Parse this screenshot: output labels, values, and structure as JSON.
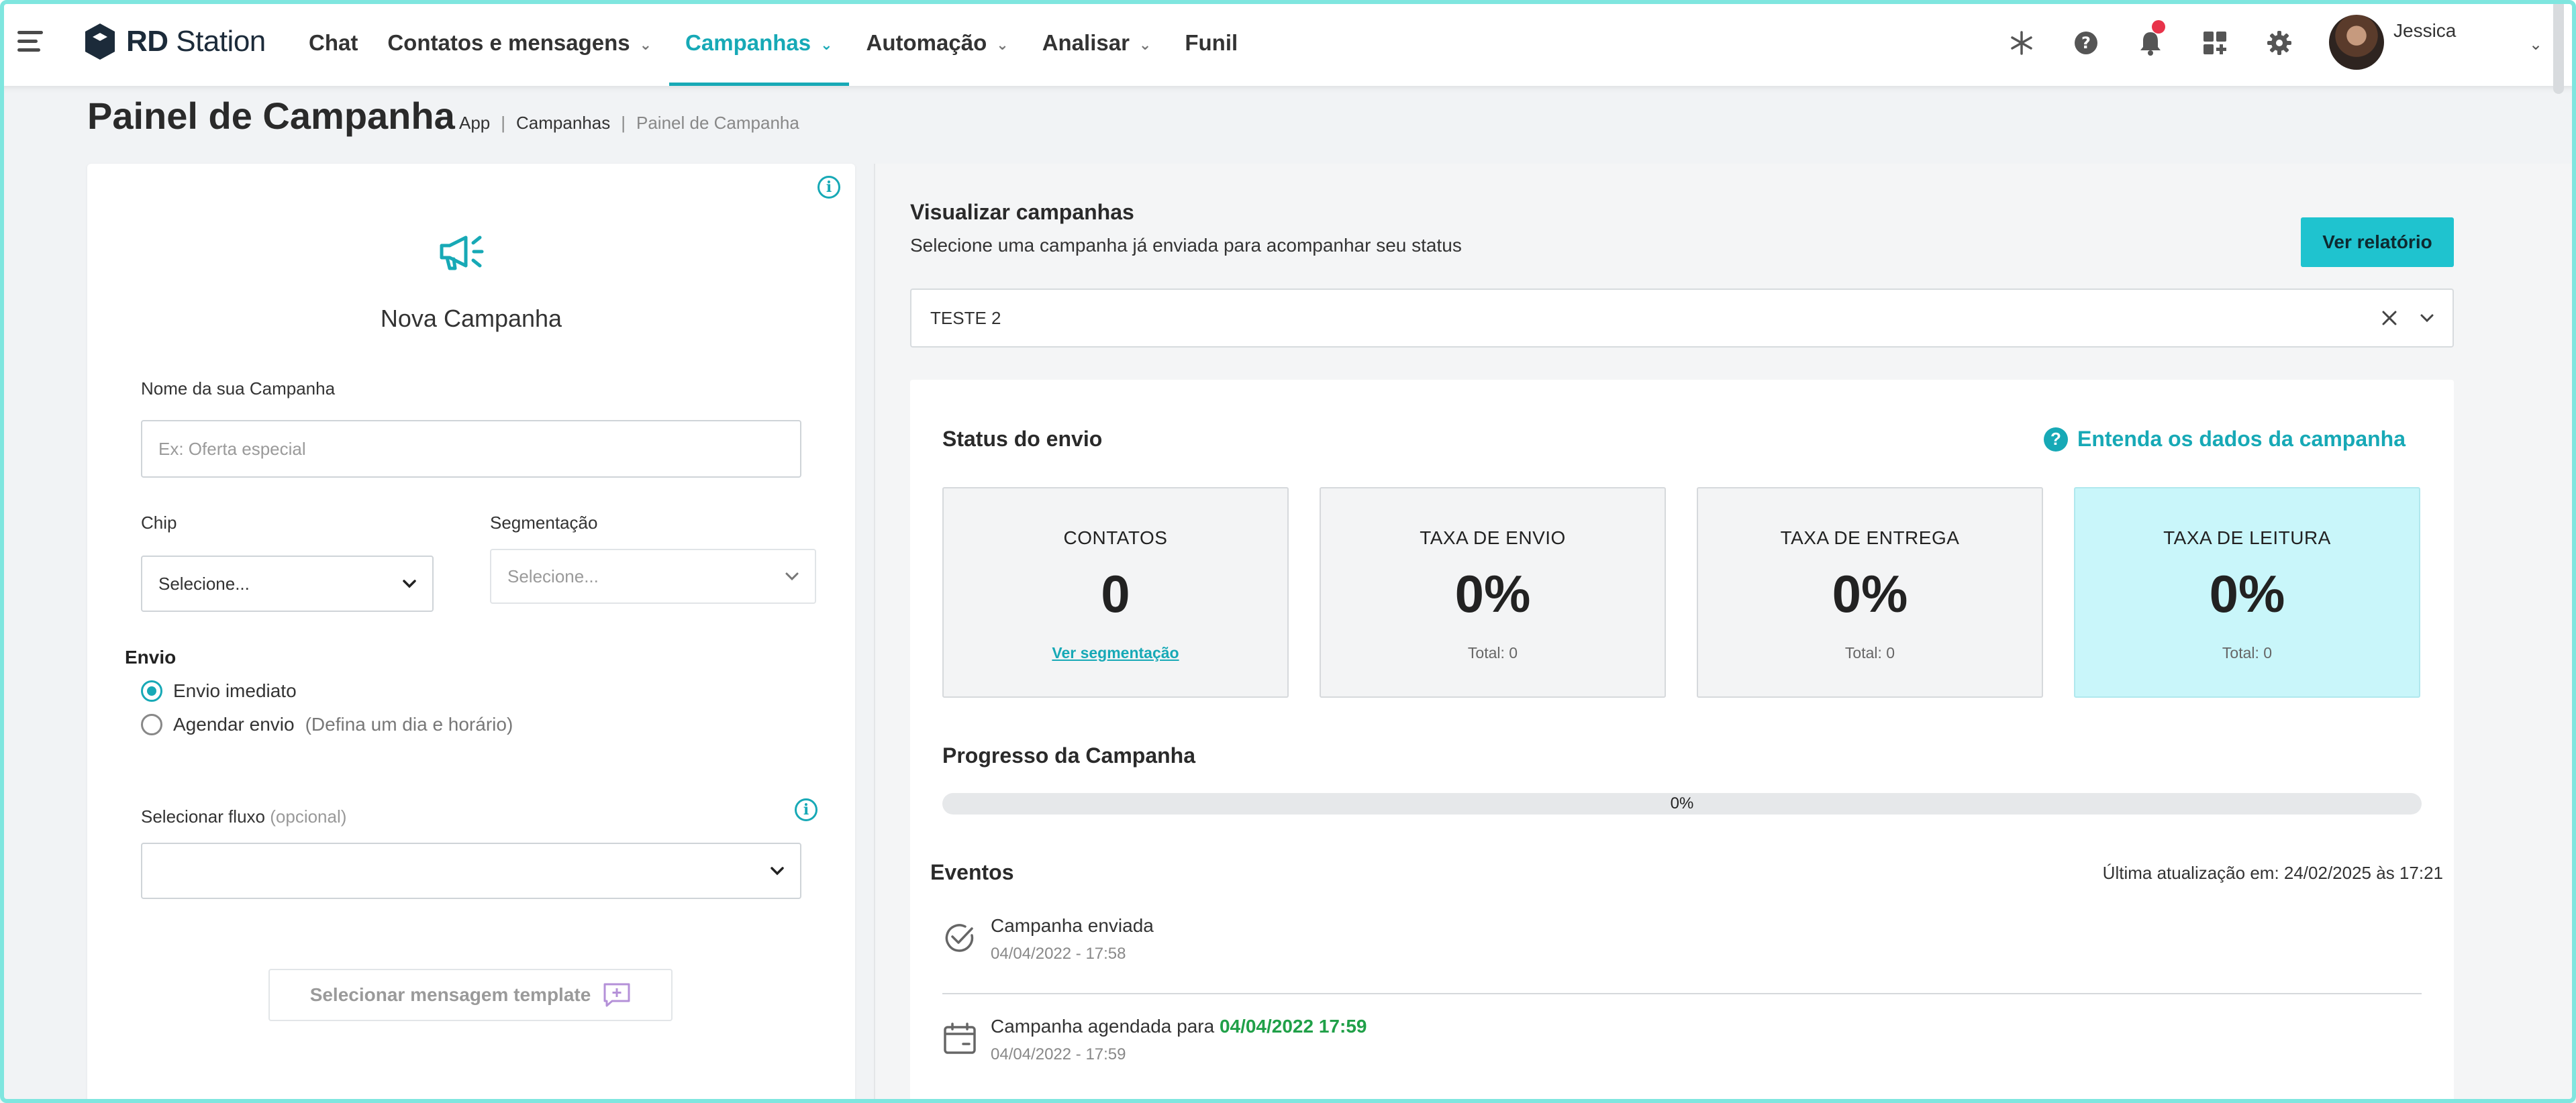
{
  "colors": {
    "accent": "#17a9b6",
    "button": "#1fc3cf",
    "highlight_card": "#c9f6fa",
    "notification": "#e8334a",
    "success": "#20a048",
    "frame": "#7fe6df"
  },
  "brand": {
    "logo_bold": "RD",
    "logo_rest": " Station",
    "icon": "rd-station-logo-icon"
  },
  "nav": {
    "items": [
      {
        "label": "Chat",
        "dropdown": false
      },
      {
        "label": "Contatos e mensagens",
        "dropdown": true
      },
      {
        "label": "Campanhas",
        "dropdown": true,
        "active": true
      },
      {
        "label": "Automação",
        "dropdown": true
      },
      {
        "label": "Analisar",
        "dropdown": true
      },
      {
        "label": "Funil",
        "dropdown": false
      }
    ]
  },
  "top_icons": [
    "snowflake-icon",
    "help-icon",
    "bell-icon",
    "apps-add-icon",
    "gear-icon"
  ],
  "user": {
    "name": "Jessica"
  },
  "page": {
    "title": "Painel de Campanha"
  },
  "breadcrumb": {
    "items": [
      "App",
      "Campanhas",
      "Painel de Campanha"
    ],
    "separator": "|"
  },
  "new_campaign": {
    "title": "Nova Campanha",
    "name_label": "Nome da sua Campanha",
    "name_placeholder": "Ex: Oferta especial",
    "chip_label": "Chip",
    "chip_value": "Selecione...",
    "segment_label": "Segmentação",
    "segment_value": "Selecione...",
    "send_title": "Envio",
    "send_options": [
      {
        "label": "Envio imediato",
        "hint": "",
        "checked": true
      },
      {
        "label": "Agendar envio",
        "hint": "(Defina um dia e horário)",
        "checked": false
      }
    ],
    "flow_label": "Selecionar fluxo",
    "flow_optional": "(opcional)",
    "flow_value": "",
    "template_button": "Selecionar mensagem template"
  },
  "view": {
    "title": "Visualizar campanhas",
    "subtitle": "Selecione uma campanha já enviada para acompanhar seu status",
    "report_button": "Ver relatório",
    "selected_campaign": "TESTE 2"
  },
  "status": {
    "title": "Status do envio",
    "help_link": "Entenda os dados da campanha",
    "cards": [
      {
        "label": "CONTATOS",
        "value": "0",
        "foot": "Ver segmentação",
        "foot_is_link": true
      },
      {
        "label": "TAXA DE ENVIO",
        "value": "0%",
        "foot": "Total: 0",
        "foot_is_link": false
      },
      {
        "label": "TAXA DE ENTREGA",
        "value": "0%",
        "foot": "Total: 0",
        "foot_is_link": false
      },
      {
        "label": "TAXA DE LEITURA",
        "value": "0%",
        "foot": "Total: 0",
        "foot_is_link": false,
        "highlight": true
      }
    ]
  },
  "progress": {
    "title": "Progresso da Campanha",
    "percent": 0,
    "label": "0%"
  },
  "events": {
    "title": "Eventos",
    "last_update": "Última atualização em: 24/02/2025 às 17:21",
    "items": [
      {
        "icon": "check-circle-icon",
        "text": "Campanha enviada",
        "highlight": "",
        "date": "04/04/2022 - 17:58"
      },
      {
        "icon": "calendar-icon",
        "text": "Campanha agendada para ",
        "highlight": "04/04/2022 17:59",
        "date": "04/04/2022 - 17:59"
      }
    ]
  }
}
